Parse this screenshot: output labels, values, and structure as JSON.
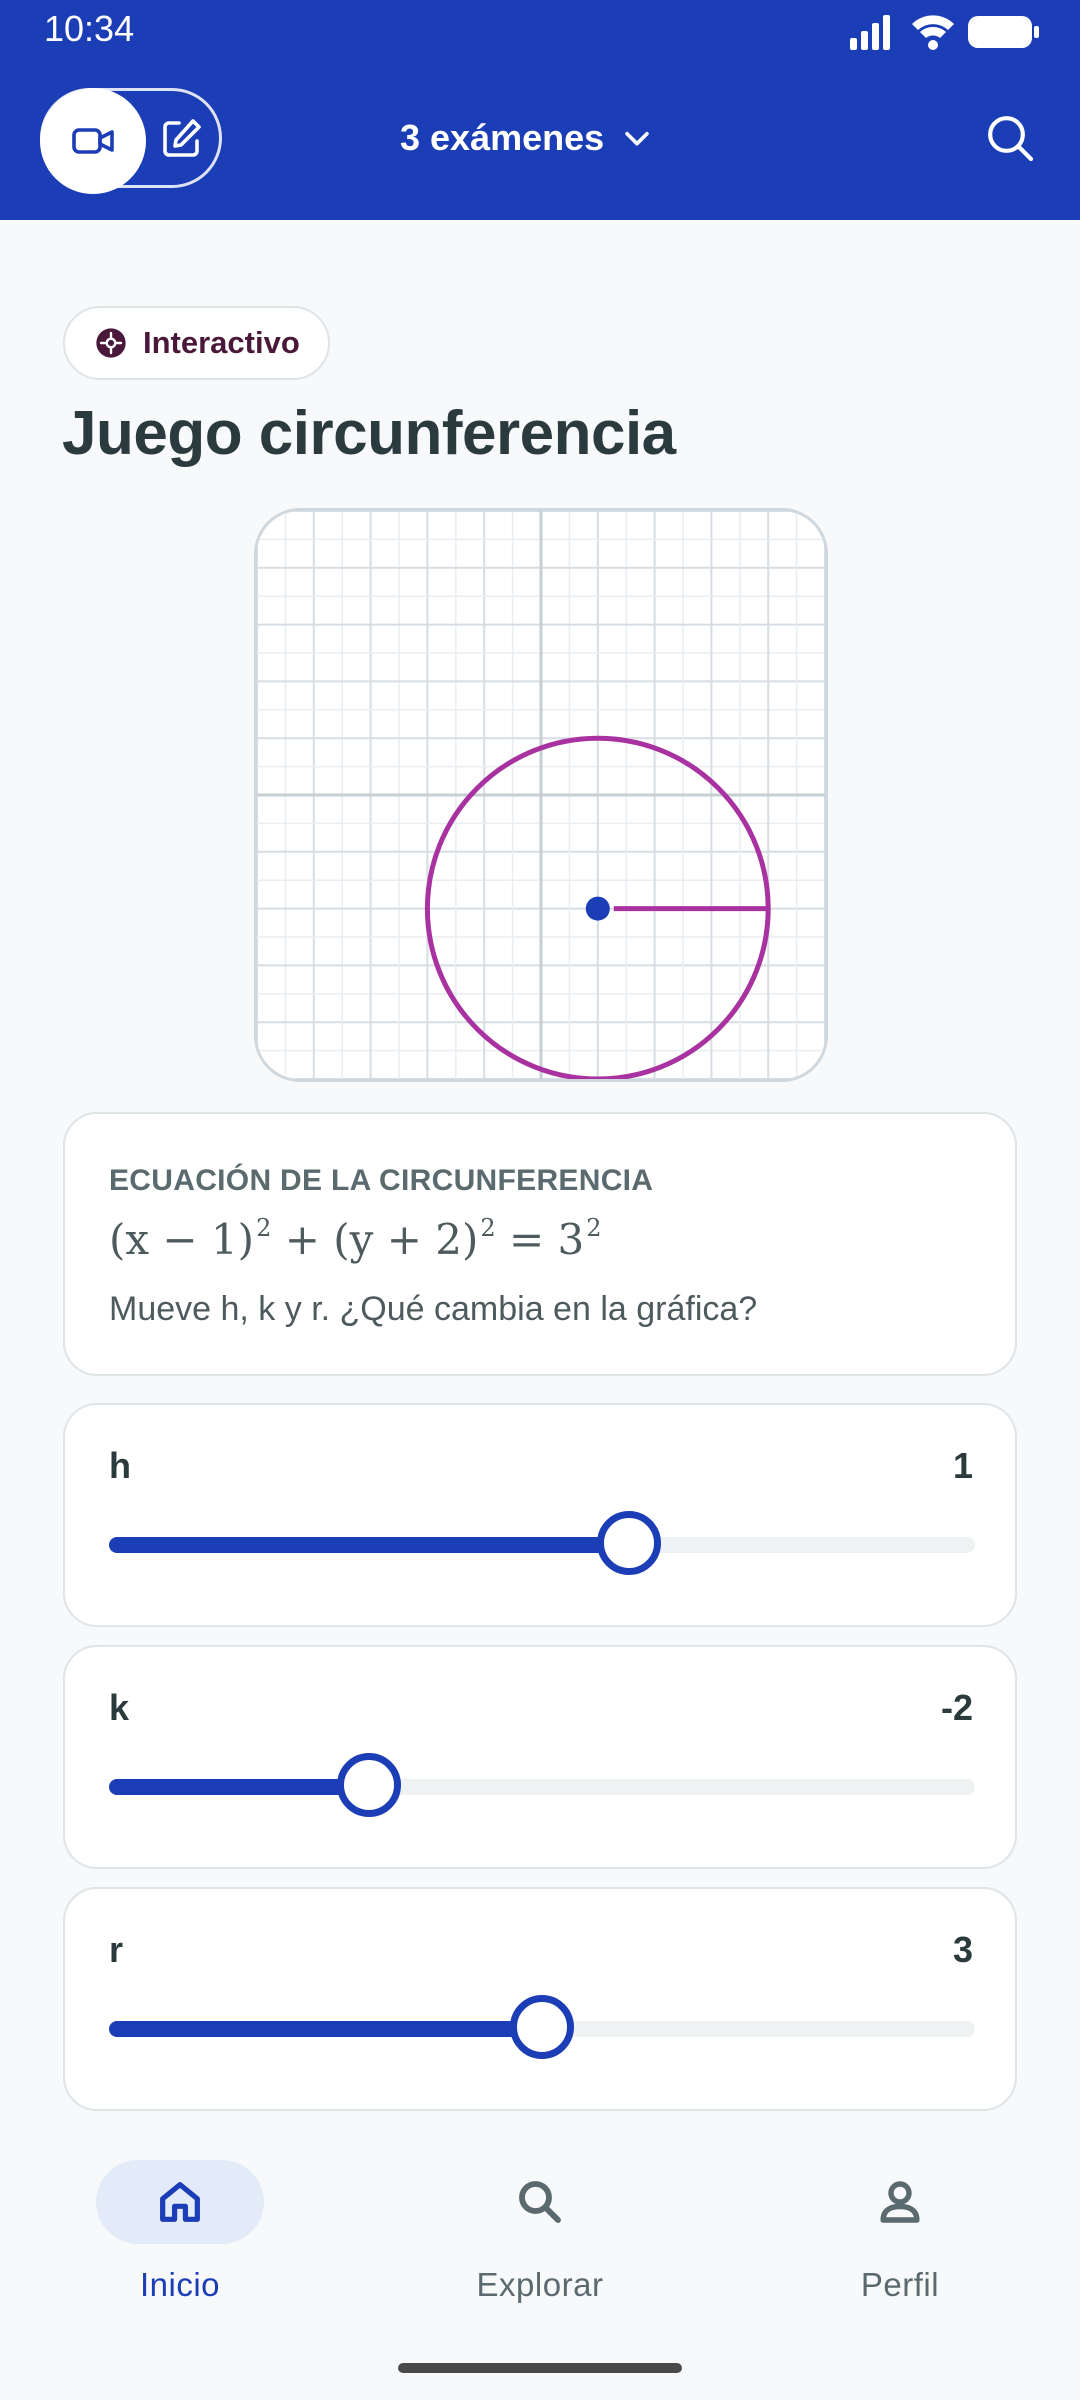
{
  "status_bar": {
    "time": "10:34"
  },
  "header": {
    "exam_selector": "3 exámenes"
  },
  "tag": {
    "label": "Interactivo"
  },
  "page_title": "Juego circunferencia",
  "graph": {
    "grid_range": [
      -5,
      5
    ],
    "center": {
      "h": 1,
      "k": -2
    },
    "radius": 3,
    "circle_color": "#a8329f",
    "center_color": "#1b3db5"
  },
  "equation_card": {
    "label": "ECUACIÓN DE LA CIRCUNFERENCIA",
    "equation": {
      "part1": "(x − 1)",
      "exp1": "2",
      "part2": " + (y + 2)",
      "exp2": "2",
      "part3": " = 3",
      "exp3": "2"
    },
    "hint": "Mueve h, k y r. ¿Qué cambia en la gráfica?"
  },
  "sliders": [
    {
      "name": "h",
      "value": "1",
      "fraction": 0.6
    },
    {
      "name": "k",
      "value": "-2",
      "fraction": 0.3
    },
    {
      "name": "r",
      "value": "3",
      "fraction": 0.5
    }
  ],
  "bottom_nav": {
    "items": [
      {
        "label": "Inicio",
        "icon": "home-icon",
        "active": true
      },
      {
        "label": "Explorar",
        "icon": "search-icon",
        "active": false
      },
      {
        "label": "Perfil",
        "icon": "person-icon",
        "active": false
      }
    ]
  },
  "colors": {
    "brand": "#1b3db5",
    "accent_circle": "#a8329f",
    "tag_text": "#4a1838"
  }
}
